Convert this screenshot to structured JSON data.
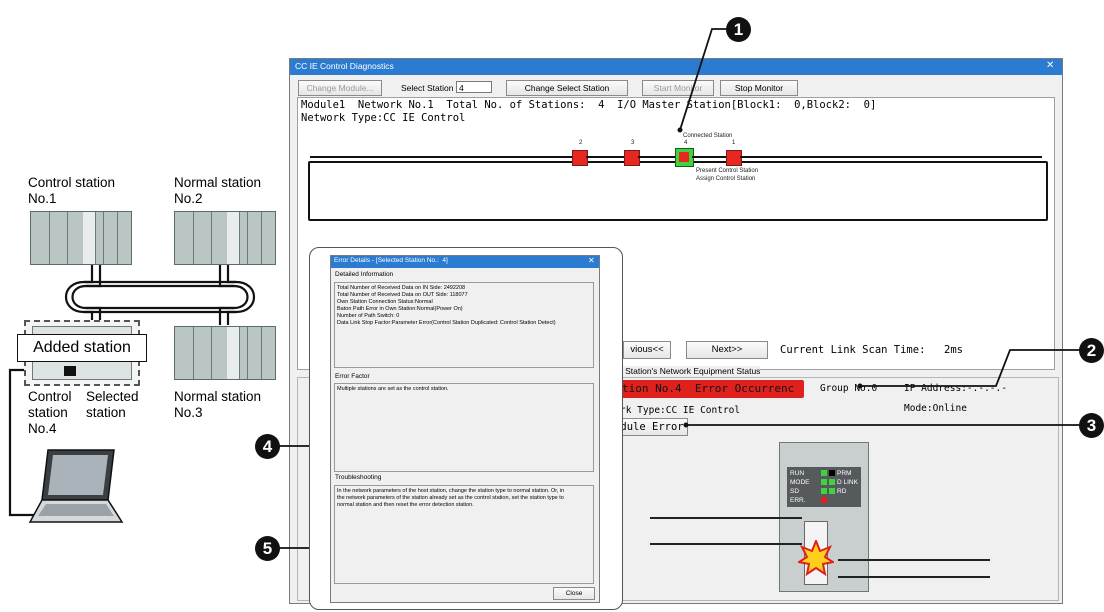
{
  "network": {
    "control_station_label": "Control station\nNo.1",
    "normal_station2_label": "Normal station\nNo.2",
    "normal_station3_label": "Normal station\nNo.3",
    "added_station_label": "Added station",
    "control_label": "Control\nstation\nNo.4",
    "selected_label": "Selected\nstation"
  },
  "window": {
    "title": "CC IE Control Diagnostics",
    "close_glyph": "✕",
    "toolbar": {
      "change_module": "Change Module...",
      "select_station_label": "Select Station",
      "select_station_value": "4",
      "change_select_station": "Change Select Station",
      "start_monitor": "Start Monitor",
      "stop_monitor": "Stop Monitor"
    },
    "info_line1": "Module1  Network No.1  Total No. of Stations:  4  I/O Master Station[Block1:  0,Block2:  0]",
    "info_line2": "Network Type:CC IE Control",
    "stations": [
      {
        "num": "2"
      },
      {
        "num": "3"
      },
      {
        "num": "4"
      },
      {
        "num": "1"
      }
    ],
    "connected_station": "Connected Station",
    "present_control": "Present Control Station",
    "assign_control": "Assign Control Station",
    "previous_btn": "vious<<",
    "next_btn": "Next>>",
    "scan_time_label": "Current Link Scan Time:",
    "scan_time_value": "2ms",
    "equipment_status_title": "d Station's Network Equipment Status",
    "station_error": "tion No.4  Error Occurrenc",
    "group_no": "Group No.0",
    "ip_address": "IP Address:-.-.-.-",
    "network_type": "rk Type:CC IE Control",
    "mode": "Mode:Online",
    "module_error_btn": "dule Error",
    "led": {
      "run": "RUN",
      "prm": "PRM",
      "mode": "MODE",
      "dlink": "D LINK",
      "sd": "SD",
      "rd": "RD",
      "err": "ERR."
    }
  },
  "dialog": {
    "title": "Error Details - [Selected Station No.:  4]",
    "close_glyph": "✕",
    "detailed_info_label": "Detailed Information",
    "detailed_lines": [
      "Total Number of Received Data on IN Side: 2492208",
      "Total Number of Received Data on OUT Side: 118077",
      "Own Station Connection Status:Normal",
      "Baton Path Error in Own Station:Normal(Power On)",
      "Number of Path Switch: 0",
      "Data Link Stop Factor:Parameter Error(Control Station Duplicated: Control Station Detect)"
    ],
    "error_factor_label": "Error Factor",
    "error_factor_text": "Multiple stations are set as the control station.",
    "troubleshooting_label": "Troubleshooting",
    "troubleshooting_lines": [
      "In the network parameters of the host station, change the station type to normal station. Or, in",
      "the network parameters of the station already set as the control station, set the station type to",
      "normal station and then reset the error detection station."
    ],
    "close_btn": "Close"
  },
  "callouts": {
    "c1": "1",
    "c2": "2",
    "c3": "3",
    "c4": "4",
    "c5": "5"
  },
  "colors": {
    "title_bar": "#2b7bd1",
    "error_red": "#e0201c",
    "led_green": "#3fd43f"
  }
}
